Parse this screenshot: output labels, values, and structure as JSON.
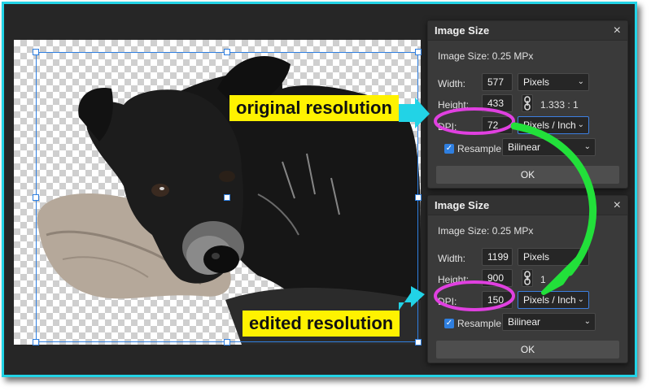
{
  "dialog_top": {
    "title": "Image Size",
    "close_glyph": "×",
    "info": "Image Size: 0.25 MPx",
    "width_label": "Width:",
    "width_value": "577",
    "width_unit": "Pixels",
    "height_label": "Height:",
    "height_value": "433",
    "ratio": "1.333 : 1",
    "dpi_label": "DPI:",
    "dpi_value": "72",
    "dpi_unit": "Pixels / Inch",
    "resample_label": "Resample",
    "resample_method": "Bilinear",
    "ok_label": "OK"
  },
  "dialog_bottom": {
    "title": "Image Size",
    "close_glyph": "×",
    "info": "Image Size: 0.25 MPx",
    "width_label": "Width:",
    "width_value": "1199",
    "width_unit": "Pixels",
    "height_label": "Height:",
    "height_value": "900",
    "ratio": "1",
    "dpi_label": "DPI:",
    "dpi_value": "150",
    "dpi_unit": "Pixels / Inch",
    "resample_label": "Resample",
    "resample_method": "Bilinear",
    "ok_label": "OK"
  },
  "annotations": {
    "original": "original resolution",
    "edited": "edited resolution"
  },
  "colors": {
    "frame_border": "#22d3e6",
    "highlight_circle": "#e040e0",
    "arrow_green": "#22e03a",
    "arrow_cyan": "#22d3e6",
    "label_bg": "#fff200"
  }
}
